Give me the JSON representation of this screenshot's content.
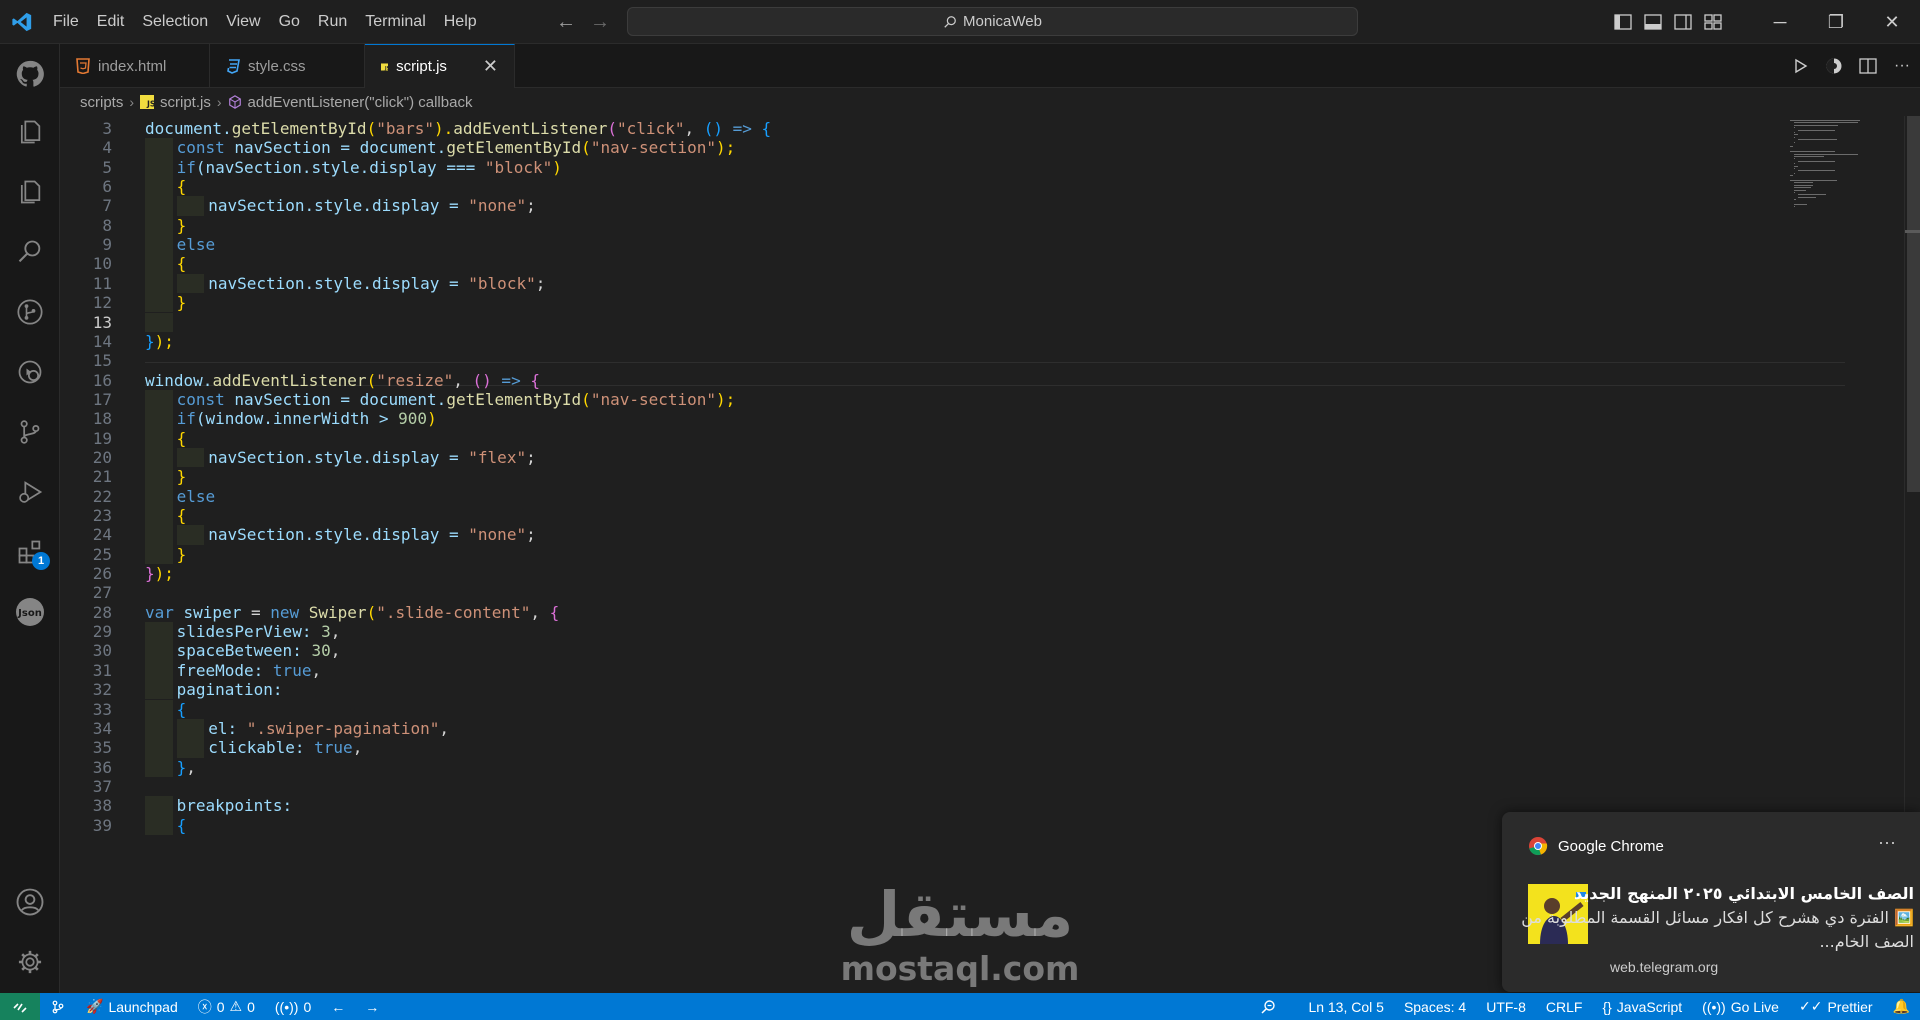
{
  "app": {
    "workspace_title": "MonicaWeb",
    "menu": [
      "File",
      "Edit",
      "Selection",
      "View",
      "Go",
      "Run",
      "Terminal",
      "Help"
    ]
  },
  "tabs": [
    {
      "label": "index.html",
      "icon": "html-file-icon",
      "color": "#e37933",
      "active": false
    },
    {
      "label": "style.css",
      "icon": "css-file-icon",
      "color": "#42a5f5",
      "active": false
    },
    {
      "label": "script.js",
      "icon": "js-file-icon",
      "color": "#f1dd3f",
      "active": true
    }
  ],
  "breadcrumb": {
    "folder": "scripts",
    "file": "script.js",
    "symbol": "addEventListener(\"click\") callback"
  },
  "editor": {
    "current_line": 13,
    "lines": [
      3,
      4,
      5,
      6,
      7,
      8,
      9,
      10,
      11,
      12,
      13,
      14,
      15,
      16,
      17,
      18,
      19,
      20,
      21,
      22,
      23,
      24,
      25,
      26,
      27,
      28,
      29,
      30,
      31,
      32,
      33,
      34,
      35,
      36,
      37,
      38,
      39
    ],
    "code": {
      "l3": [
        "document.",
        "getElementById",
        "(",
        "\"bars\"",
        ").",
        "addEventListener",
        "(",
        "\"click\"",
        ", ",
        "()",
        " => ",
        "{"
      ],
      "l4": [
        "const ",
        "navSection",
        " = document.",
        "getElementById",
        "(",
        "\"nav-section\"",
        ");"
      ],
      "l5": [
        "if",
        "(navSection.style.display === ",
        "\"block\"",
        ")"
      ],
      "l6": [
        "{"
      ],
      "l7": [
        "navSection.style.display = ",
        "\"none\"",
        ";"
      ],
      "l8": [
        "}"
      ],
      "l9": [
        "else"
      ],
      "l10": [
        "{"
      ],
      "l11": [
        "navSection.style.display = ",
        "\"block\"",
        ";"
      ],
      "l12": [
        "}"
      ],
      "l14": [
        "}",
        ");"
      ],
      "l16": [
        "window.",
        "addEventListener",
        "(",
        "\"resize\"",
        ", ",
        "()",
        " => ",
        "{"
      ],
      "l17": [
        "const ",
        "navSection",
        " = document.",
        "getElementById",
        "(",
        "\"nav-section\"",
        ");"
      ],
      "l18": [
        "if",
        "(window.innerWidth > ",
        "900",
        ")"
      ],
      "l19": [
        "{"
      ],
      "l20": [
        "navSection.style.display = ",
        "\"flex\"",
        ";"
      ],
      "l21": [
        "}"
      ],
      "l22": [
        "else"
      ],
      "l23": [
        "{"
      ],
      "l24": [
        "navSection.style.display = ",
        "\"none\"",
        ";"
      ],
      "l25": [
        "}"
      ],
      "l26": [
        "}",
        ");"
      ],
      "l28": [
        "var ",
        "swiper",
        " = ",
        "new ",
        "Swiper",
        "(",
        "\".slide-content\"",
        ", ",
        "{"
      ],
      "l29": [
        "slidesPerView: ",
        "3",
        ","
      ],
      "l30": [
        "spaceBetween: ",
        "30",
        ","
      ],
      "l31": [
        "freeMode: ",
        "true",
        ","
      ],
      "l32": [
        "pagination:"
      ],
      "l33": [
        "{"
      ],
      "l34": [
        "el: ",
        "\".swiper-pagination\"",
        ","
      ],
      "l35": [
        "clickable: ",
        "true",
        ","
      ],
      "l36": [
        "}",
        ","
      ],
      "l38": [
        "breakpoints:"
      ],
      "l39": [
        "{"
      ]
    }
  },
  "notification": {
    "app": "Google Chrome",
    "title": "الصف الخامس الابتدائي ٢٠٢٥ المنهج الجديد",
    "body": "🖼️ الفترة دي هشرح كل افكار مسائل القسمة المطلوبة من الصف الخام...",
    "url": "web.telegram.org"
  },
  "watermark": {
    "arabic": "مستقل",
    "latin": "mostaql.com"
  },
  "statusbar": {
    "launchpad": "Launchpad",
    "errors": "0",
    "warnings": "0",
    "ports": "0",
    "position": "Ln 13, Col 5",
    "spaces": "Spaces: 4",
    "encoding": "UTF-8",
    "eol": "CRLF",
    "language": "JavaScript",
    "golive": "Go Live",
    "prettier": "Prettier"
  },
  "colors": {
    "accent": "#0078d4",
    "remote": "#16825d",
    "editor_bg": "#1f1f1f"
  }
}
